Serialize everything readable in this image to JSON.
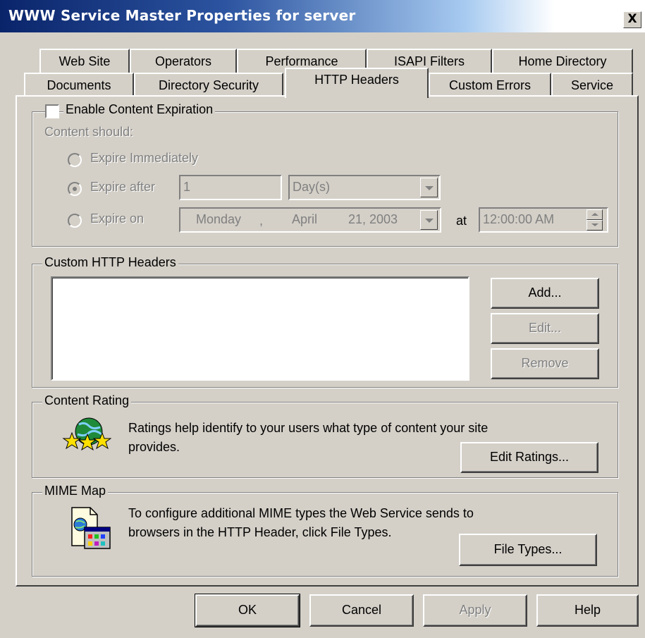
{
  "window": {
    "title": "WWW Service Master Properties for server",
    "close_glyph": "X"
  },
  "tabs": {
    "row1": [
      "Web Site",
      "Operators",
      "Performance",
      "ISAPI Filters",
      "Home Directory"
    ],
    "row2": [
      "Documents",
      "Directory Security",
      "HTTP Headers",
      "Custom Errors",
      "Service"
    ],
    "selected": "HTTP Headers"
  },
  "expiration": {
    "enable_label": "Enable Content Expiration",
    "enabled": false,
    "content_should": "Content should:",
    "expire_immediately": "Expire Immediately",
    "expire_after": "Expire after",
    "expire_after_value": "1",
    "expire_after_unit": "Day(s)",
    "expire_on": "Expire on",
    "selected_option": "Expire after",
    "date_weekday": "Monday",
    "date_sep": ",",
    "date_month": "April",
    "date_day_year": "21, 2003",
    "at_label": "at",
    "time_value": "12:00:00 AM"
  },
  "custom_headers": {
    "legend": "Custom HTTP Headers",
    "items": [],
    "add_label": "Add...",
    "edit_label": "Edit...",
    "remove_label": "Remove"
  },
  "content_rating": {
    "legend": "Content Rating",
    "text_line1": "Ratings help identify to your users what type of content your site",
    "text_line2": "provides.",
    "edit_ratings_label": "Edit Ratings...",
    "icon": "globe-stars-icon"
  },
  "mime_map": {
    "legend": "MIME Map",
    "text_line1": "To configure additional MIME types the Web Service sends to",
    "text_line2": "browsers in the HTTP Header, click File Types.",
    "file_types_label": "File Types...",
    "icon": "mime-document-icon"
  },
  "footer": {
    "ok": "OK",
    "cancel": "Cancel",
    "apply": "Apply",
    "help": "Help"
  },
  "colors": {
    "face": "#d4d0c8",
    "title_start": "#0a246a",
    "title_end": "#a6caf0",
    "disabled_text": "#808080"
  }
}
